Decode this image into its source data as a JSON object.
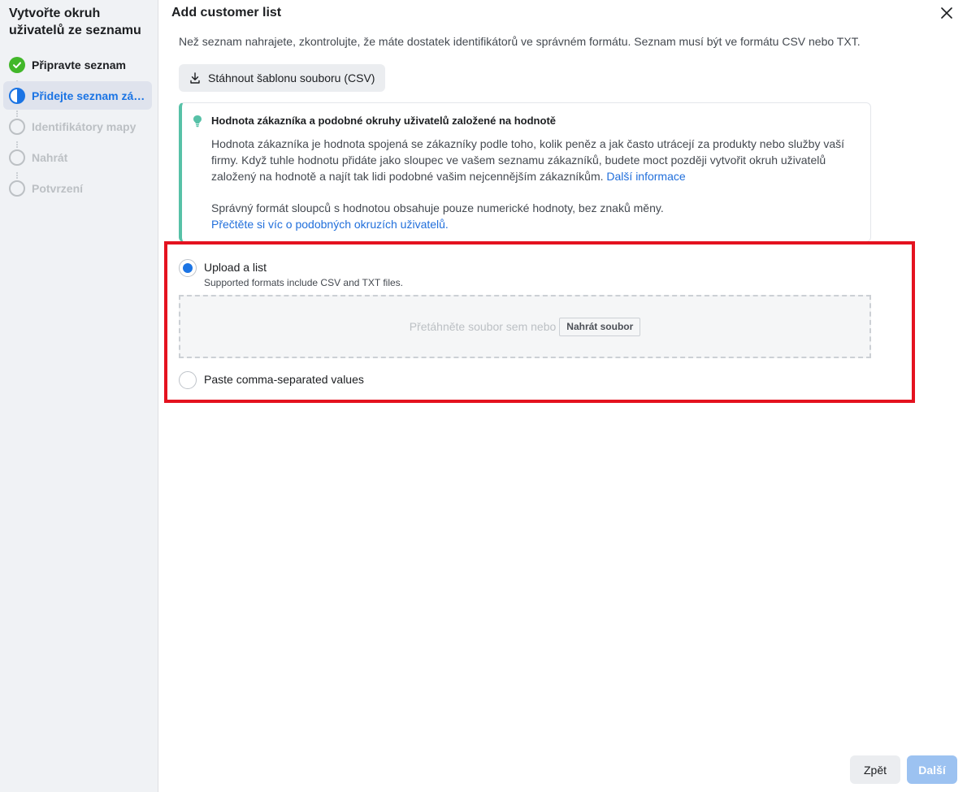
{
  "sidebar": {
    "title": "Vytvořte okruh uživatelů ze seznamu",
    "steps": [
      {
        "label": "Připravte seznam",
        "state": "done"
      },
      {
        "label": "Přidejte seznam zákazníků",
        "state": "active"
      },
      {
        "label": "Identifikátory mapy",
        "state": "todo"
      },
      {
        "label": "Nahrát",
        "state": "todo"
      },
      {
        "label": "Potvrzení",
        "state": "todo"
      }
    ]
  },
  "header": {
    "title": "Add customer list",
    "close_icon": "close-icon"
  },
  "intro": "Než seznam nahrajete, zkontrolujte, že máte dostatek identifikátorů ve správném formátu. Seznam musí být ve formátu CSV nebo TXT.",
  "download_button": {
    "label": "Stáhnout šablonu souboru (CSV)",
    "icon": "download-icon"
  },
  "info_card": {
    "title": "Hodnota zákazníka a podobné okruhy uživatelů založené na hodnotě",
    "body": "Hodnota zákazníka je hodnota spojená se zákazníky podle toho, kolik peněz a jak často utrácejí za produkty nebo služby vaší firmy. Když tuhle hodnotu přidáte jako sloupec ve vašem seznamu zákazníků, budete moct později vytvořit okruh uživatelů založený na hodnotě a najít tak lidi podobné vašim nejcennějším zákazníkům.",
    "body_link": "Další informace",
    "body2": "Správný formát sloupců s hodnotou obsahuje pouze numerické hodnoty, bez znaků měny.",
    "body2_link": "Přečtěte si víc o podobných okruzích uživatelů.",
    "icon": "lightbulb-icon",
    "accent_color": "#57c1a7"
  },
  "upload_options": {
    "upload": {
      "label": "Upload a list",
      "sub": "Supported formats include CSV and TXT files.",
      "selected": true
    },
    "paste": {
      "label": "Paste comma-separated values",
      "selected": false
    },
    "dropzone_text": "Přetáhněte soubor sem nebo",
    "dropzone_button": "Nahrát soubor"
  },
  "footer": {
    "back_label": "Zpět",
    "next_label": "Další"
  },
  "colors": {
    "primary": "#1b74e4",
    "done": "#42b72a",
    "highlight": "#e4121f"
  }
}
